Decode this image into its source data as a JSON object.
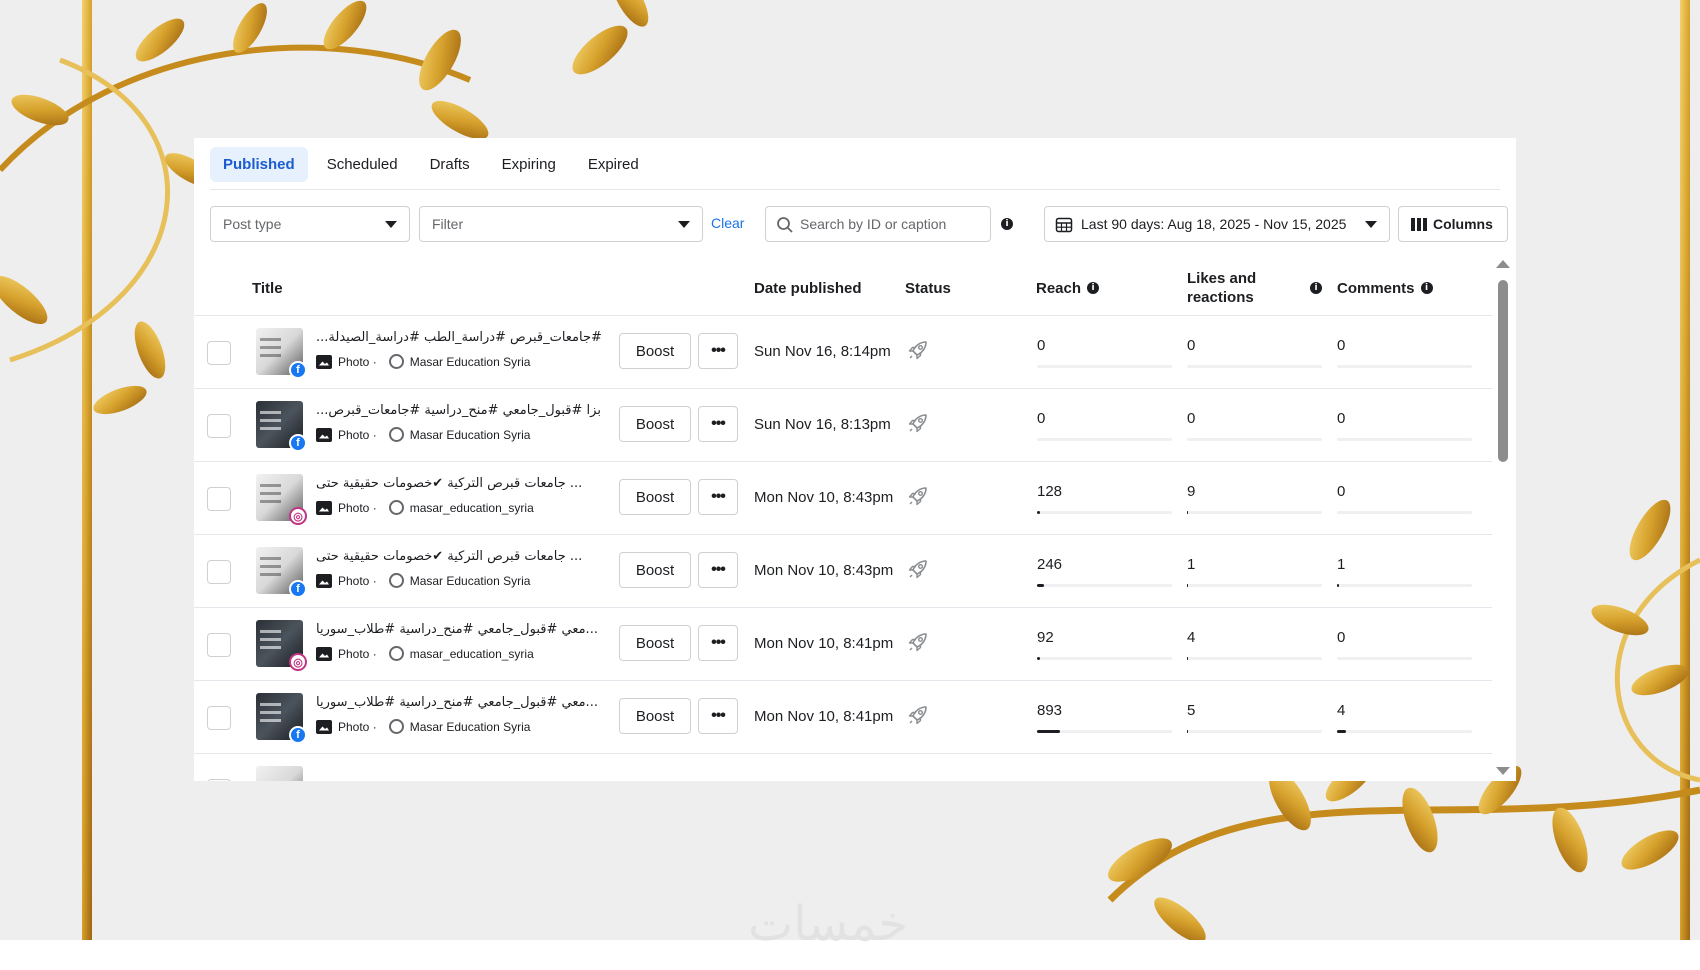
{
  "tabs": [
    {
      "label": "Published",
      "active": true
    },
    {
      "label": "Scheduled",
      "active": false
    },
    {
      "label": "Drafts",
      "active": false
    },
    {
      "label": "Expiring",
      "active": false
    },
    {
      "label": "Expired",
      "active": false
    }
  ],
  "filters": {
    "post_type_placeholder": "Post type",
    "filter_placeholder": "Filter",
    "clear_label": "Clear",
    "search_placeholder": "Search by ID or caption",
    "date_range": "Last 90 days: Aug 18, 2025 - Nov 15, 2025",
    "columns_label": "Columns"
  },
  "table": {
    "headers": {
      "title": "Title",
      "date": "Date published",
      "status": "Status",
      "reach": "Reach",
      "likes": "Likes and reactions",
      "comments": "Comments"
    },
    "rows": [
      {
        "caption": "#جامعات_قبرص #دراسة_الطب #دراسة_الصيدلة...",
        "type": "Photo ·",
        "account": "Masar Education Syria",
        "platform": "facebook",
        "thumb": "light",
        "boost": "Boost",
        "date": "Sun Nov 16, 8:14pm",
        "reach": "0",
        "reach_pct": 0,
        "likes": "0",
        "likes_pct": 0,
        "comments": "0",
        "comments_pct": 0
      },
      {
        "caption": "بزا #قبول_جامعي #منح_دراسية #جامعات_قبرص...",
        "type": "Photo ·",
        "account": "Masar Education Syria",
        "platform": "facebook",
        "thumb": "dark",
        "boost": "Boost",
        "date": "Sun Nov 16, 8:13pm",
        "reach": "0",
        "reach_pct": 0,
        "likes": "0",
        "likes_pct": 0,
        "comments": "0",
        "comments_pct": 0
      },
      {
        "caption": "... جامعات قبرص التركية ✔خصومات حقيقية حتى",
        "type": "Photo ·",
        "account": "masar_education_syria",
        "platform": "instagram",
        "thumb": "light",
        "boost": "Boost",
        "date": "Mon Nov 10, 8:43pm",
        "reach": "128",
        "reach_pct": 2,
        "likes": "9",
        "likes_pct": 1,
        "comments": "0",
        "comments_pct": 0
      },
      {
        "caption": "... جامعات قبرص التركية ✔خصومات حقيقية حتى",
        "type": "Photo ·",
        "account": "Masar Education Syria",
        "platform": "facebook",
        "thumb": "light",
        "boost": "Boost",
        "date": "Mon Nov 10, 8:43pm",
        "reach": "246",
        "reach_pct": 5,
        "likes": "1",
        "likes_pct": 0.5,
        "comments": "1",
        "comments_pct": 1.5
      },
      {
        "caption": "...معي #قبول_جامعي #منح_دراسية #طلاب_سوريا",
        "type": "Photo ·",
        "account": "masar_education_syria",
        "platform": "instagram",
        "thumb": "dark",
        "boost": "Boost",
        "date": "Mon Nov 10, 8:41pm",
        "reach": "92",
        "reach_pct": 2,
        "likes": "4",
        "likes_pct": 0.5,
        "comments": "0",
        "comments_pct": 0
      },
      {
        "caption": "...معي #قبول_جامعي #منح_دراسية #طلاب_سوريا",
        "type": "Photo ·",
        "account": "Masar Education Syria",
        "platform": "facebook",
        "thumb": "dark",
        "boost": "Boost",
        "date": "Mon Nov 10, 8:41pm",
        "reach": "893",
        "reach_pct": 17,
        "likes": "5",
        "likes_pct": 0.5,
        "comments": "4",
        "comments_pct": 7
      }
    ]
  },
  "colors": {
    "accent": "#1b74e4",
    "active_tab_bg": "#e7f0fd",
    "gold": "#d4a12a",
    "gold_dark": "#a9700f"
  },
  "watermark": "خمسات"
}
